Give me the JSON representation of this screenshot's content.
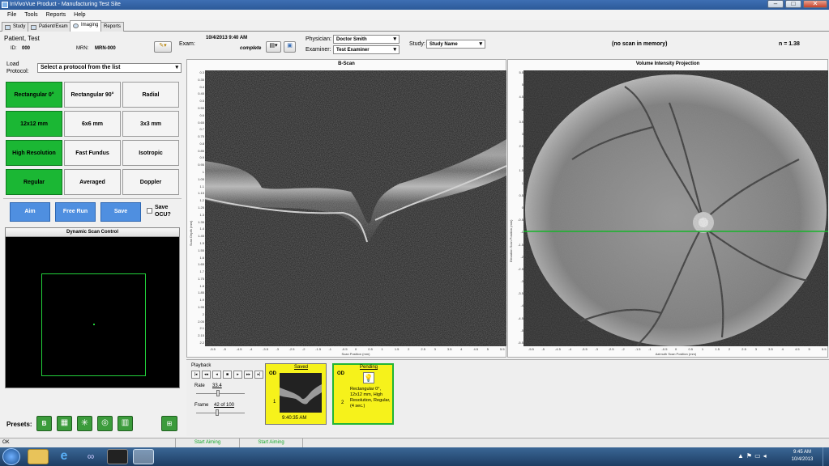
{
  "window": {
    "title": "InVivoVue Product - Manufacturing Test Site"
  },
  "menu": [
    "File",
    "Tools",
    "Reports",
    "Help"
  ],
  "tabs": [
    "Study",
    "Patient/Exam",
    "Imaging",
    "Reports"
  ],
  "patient": {
    "name": "Patient, Test",
    "id_label": "ID:",
    "id_value": "000",
    "mrn_label": "MRN:",
    "mrn_value": "MRN-000"
  },
  "exam": {
    "label": "Exam:",
    "date": "10/4/2013 9:40 AM",
    "status": "complete"
  },
  "physician": {
    "label": "Physician:",
    "value": "Doctor Smith"
  },
  "examiner": {
    "label": "Examiner:",
    "value": "Test Examiner"
  },
  "study": {
    "label": "Study:",
    "value": "Study Name"
  },
  "scan_memory": "(no scan in memory)",
  "n_value": "n = 1.38",
  "protocol": {
    "label": "Load Protocol:",
    "value": "Select a protocol from the list"
  },
  "grid": [
    {
      "label": "Rectangular 0°",
      "selected": true
    },
    {
      "label": "Rectangular 90°",
      "selected": false
    },
    {
      "label": "Radial",
      "selected": false
    },
    {
      "label": "12x12 mm",
      "selected": true
    },
    {
      "label": "6x6 mm",
      "selected": false
    },
    {
      "label": "3x3 mm",
      "selected": false
    },
    {
      "label": "High Resolution",
      "selected": true
    },
    {
      "label": "Fast Fundus",
      "selected": false
    },
    {
      "label": "Isotropic",
      "selected": false
    },
    {
      "label": "Regular",
      "selected": true
    },
    {
      "label": "Averaged",
      "selected": false
    },
    {
      "label": "Doppler",
      "selected": false
    }
  ],
  "actions": {
    "aim": "Aim",
    "free_run": "Free Run",
    "save": "Save",
    "save_ocu": "Save OCU?"
  },
  "dsc": {
    "title": "Dynamic Scan Control"
  },
  "presets": {
    "label": "Presets:"
  },
  "bscan": {
    "title": "B-Scan",
    "ylabel": "Scan Depth (mm)",
    "xlabel": "Scan Position (mm)",
    "yticks": [
      "0.3",
      "0.35",
      "0.4",
      "0.45",
      "0.5",
      "0.55",
      "0.6",
      "0.65",
      "0.7",
      "0.75",
      "0.8",
      "0.85",
      "0.9",
      "0.95",
      "1",
      "1.05",
      "1.1",
      "1.15",
      "1.2",
      "1.25",
      "1.3",
      "1.35",
      "1.4",
      "1.45",
      "1.5",
      "1.55",
      "1.6",
      "1.65",
      "1.7",
      "1.75",
      "1.8",
      "1.85",
      "1.9",
      "1.95",
      "2",
      "2.05",
      "2.1",
      "2.15",
      "2.2"
    ],
    "xticks": [
      "-5.5",
      "-5",
      "-4.5",
      "-4",
      "-3.5",
      "-3",
      "-2.5",
      "-2",
      "-1.5",
      "-1",
      "-0.5",
      "0",
      "0.5",
      "1",
      "1.5",
      "2",
      "2.5",
      "3",
      "3.5",
      "4",
      "4.5",
      "5",
      "5.5"
    ]
  },
  "vip": {
    "title": "Volume Intensity Projection",
    "ylabel": "Elevation Scan Position (mm)",
    "xlabel": "Azimuth Scan Position (mm)",
    "yticks": [
      "5.5",
      "5",
      "4.5",
      "4",
      "3.5",
      "3",
      "2.5",
      "2",
      "1.5",
      "1",
      "0.5",
      "0",
      "-0.5",
      "-1",
      "-1.5",
      "-2",
      "-2.5",
      "-3",
      "-3.5",
      "-4",
      "-4.5",
      "-5",
      "-5.5"
    ],
    "xticks": [
      "-5.5",
      "-5",
      "-4.5",
      "-4",
      "-3.5",
      "-3",
      "-2.5",
      "-2",
      "-1.5",
      "-1",
      "-0.5",
      "0",
      "0.5",
      "1",
      "1.5",
      "2",
      "2.5",
      "3",
      "3.5",
      "4",
      "4.5",
      "5",
      "5.5"
    ]
  },
  "playback": {
    "label": "Playback",
    "buttons": [
      "|◂",
      "◂◂",
      "◂",
      "■",
      "▸",
      "▸▸",
      "▸|"
    ],
    "rate_label": "Rate",
    "rate_value": "33.4",
    "frame_label": "Frame",
    "frame_value": "42 of 100",
    "rate_level": 0.45,
    "frame_level": 0.42
  },
  "cards": [
    {
      "eye": "OD",
      "status": "Saved",
      "num": "1",
      "time": "9:40:35 AM"
    },
    {
      "eye": "OD",
      "status": "Pending",
      "num": "2",
      "desc": "Rectangular 0°, 12x12 mm, High Resolution, Regular, (4 sec.)"
    }
  ],
  "statusbar": {
    "left": "OK",
    "s1": "Start Aiming",
    "s2": "Start Aiming"
  },
  "taskbar": {
    "time": "9:45 AM",
    "date": "10/4/2013"
  }
}
